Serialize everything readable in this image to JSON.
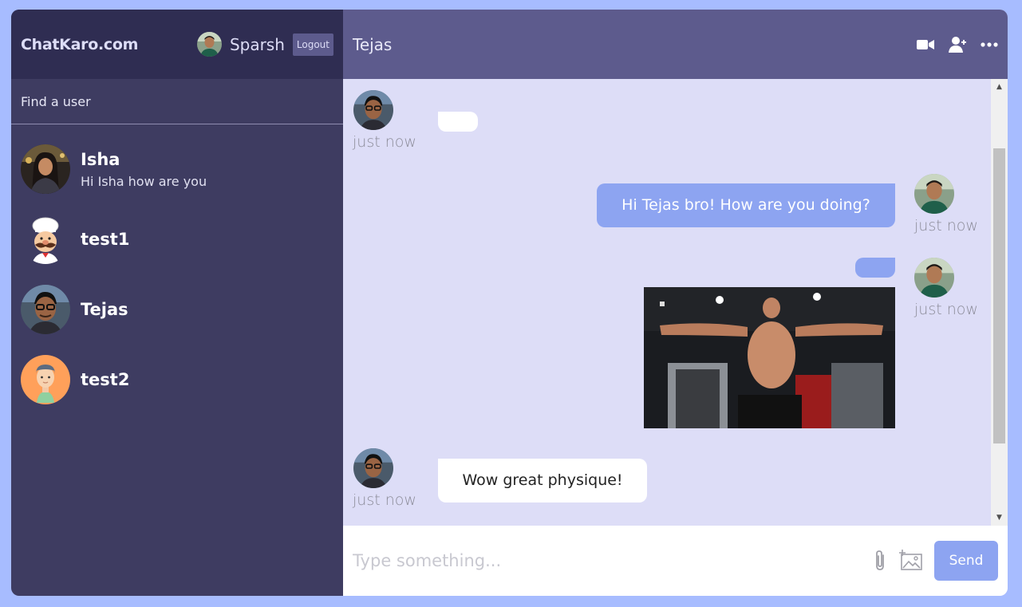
{
  "sidebar": {
    "logo": "ChatKaro.com",
    "current_user": "Sparsh",
    "logout_label": "Logout",
    "search_placeholder": "Find a user",
    "chats": [
      {
        "name": "Isha",
        "last_message": "Hi Isha how are you"
      },
      {
        "name": "test1",
        "last_message": ""
      },
      {
        "name": "Tejas",
        "last_message": ""
      },
      {
        "name": "test2",
        "last_message": ""
      }
    ]
  },
  "chat": {
    "title": "Tejas",
    "messages": [
      {
        "from": "Tejas",
        "text": "",
        "time": "just now"
      },
      {
        "from": "Sparsh",
        "text": "Hi Tejas bro! How are you doing?",
        "time": "just now"
      },
      {
        "from": "Sparsh",
        "text": "",
        "time": "just now",
        "has_image": true
      },
      {
        "from": "Tejas",
        "text": "Wow great physique!",
        "time": "just now"
      }
    ],
    "input_placeholder": "Type something...",
    "send_label": "Send"
  },
  "icons": {
    "video": "video-camera-icon",
    "add_user": "add-user-icon",
    "more": "more-dots-icon",
    "attach": "paperclip-icon",
    "add_image": "add-image-icon"
  },
  "colors": {
    "background": "#a7bcff",
    "sidebar": "#3e3c61",
    "navbar": "#2f2d52",
    "chat_header": "#5d5b8d",
    "chat_bg": "#ddddf7",
    "owner_bubble": "#8da4f1",
    "send_button": "#8da4f1"
  }
}
